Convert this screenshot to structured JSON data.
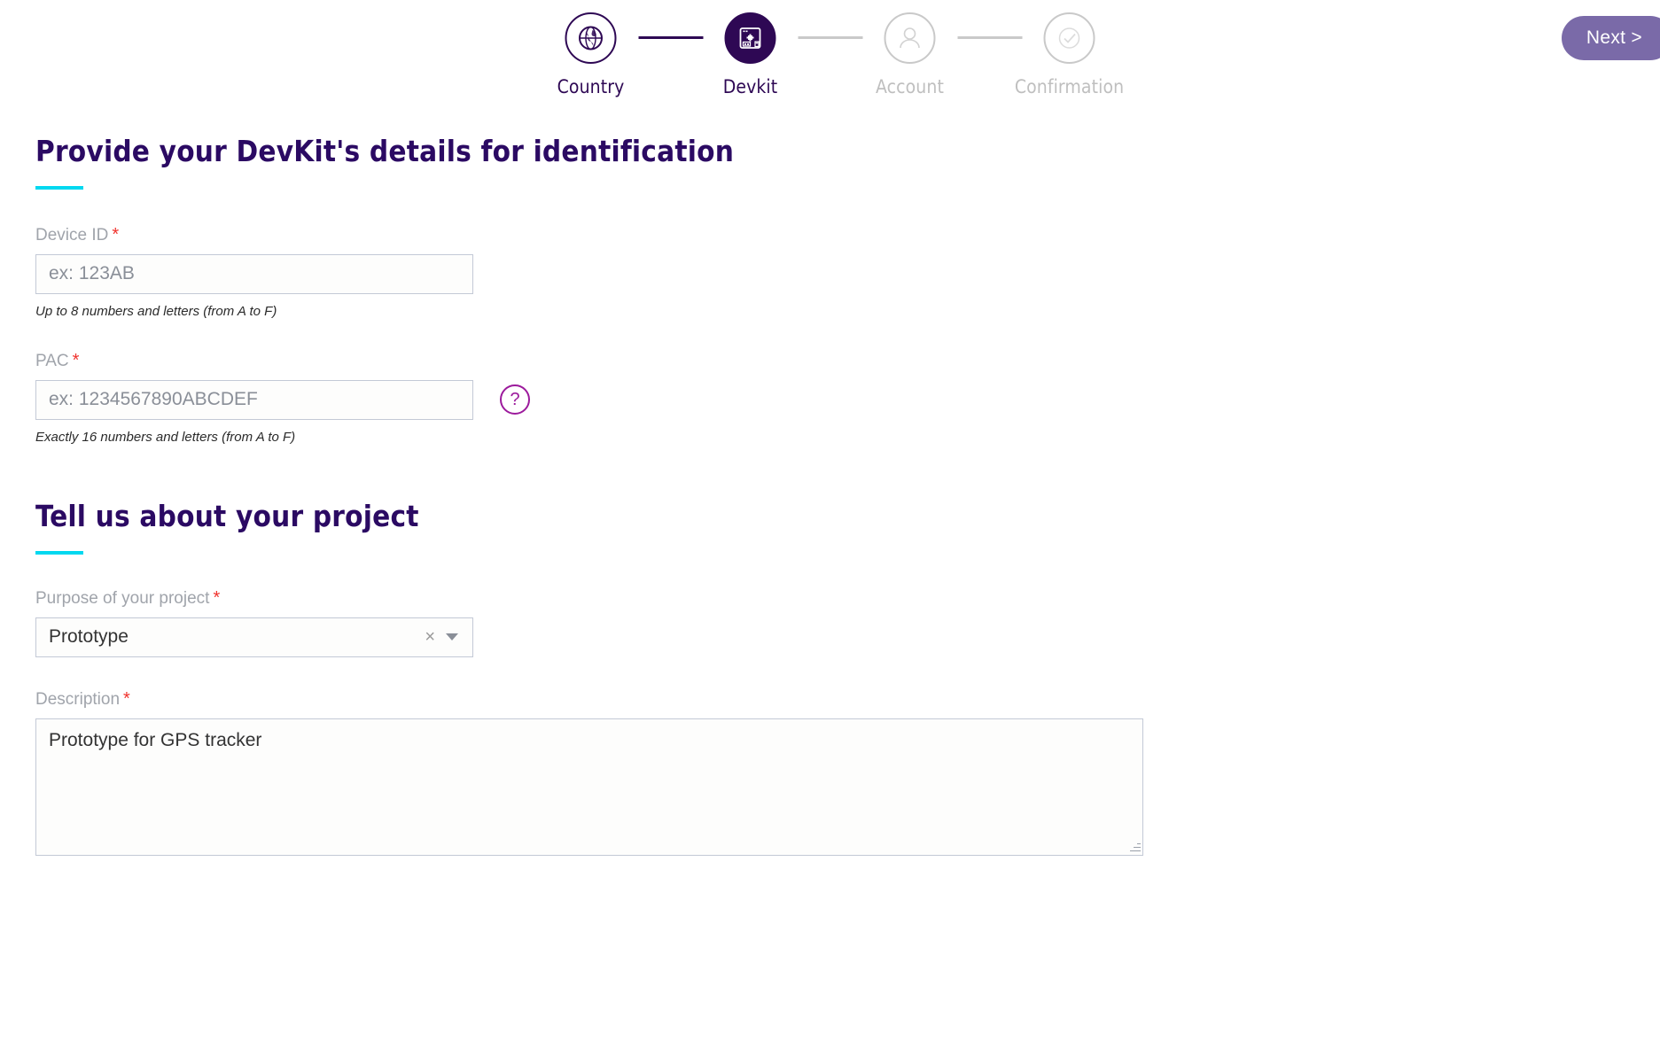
{
  "stepper": {
    "steps": [
      {
        "label": "Country",
        "icon": "globe-icon",
        "state": "completed"
      },
      {
        "label": "Devkit",
        "icon": "devkit-board-icon",
        "state": "current"
      },
      {
        "label": "Account",
        "icon": "person-icon",
        "state": "inactive"
      },
      {
        "label": "Confirmation",
        "icon": "check-circle-icon",
        "state": "inactive"
      }
    ]
  },
  "header": {
    "next_label": "Next >"
  },
  "sections": [
    {
      "title": "Provide your DevKit's details for identification"
    },
    {
      "title": "Tell us about your project"
    }
  ],
  "device_id": {
    "label": "Device ID",
    "required_mark": "*",
    "placeholder": "ex: 123AB",
    "value": "",
    "hint": "Up to 8 numbers and letters (from A to F)"
  },
  "pac": {
    "label": "PAC",
    "required_mark": "*",
    "placeholder": "ex: 1234567890ABCDEF",
    "value": "",
    "hint": "Exactly 16 numbers and letters (from A to F)",
    "help_icon_label": "?"
  },
  "purpose": {
    "label": "Purpose of your project",
    "required_mark": "*",
    "selected": "Prototype",
    "clear_label": "×"
  },
  "description": {
    "label": "Description",
    "required_mark": "*",
    "value": "Prototype for GPS tracker"
  },
  "colors": {
    "primary_dark": "#2e0854",
    "heading": "#2b0a63",
    "accent_cyan": "#00d8f0",
    "next_button": "#7a6aa8",
    "required_red": "#f0322d",
    "help_purple": "#9c1a9c",
    "inactive_grey": "#c9c9c9"
  }
}
